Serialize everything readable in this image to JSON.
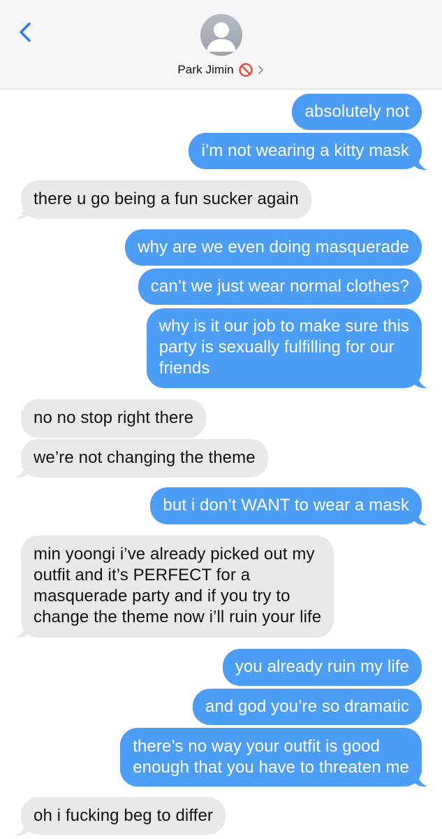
{
  "header": {
    "contact_name": "Park Jimin",
    "back_icon": "chevron-left-icon",
    "mute_icon": "prohibited-icon",
    "disclosure_icon": "chevron-right-icon",
    "colors": {
      "accent": "#3478f6",
      "mute": "#e0543d"
    }
  },
  "colors": {
    "outgoing": "#4b9df6",
    "incoming": "#e9e9eb"
  },
  "messages": [
    {
      "from": "me",
      "text": "absolutely not"
    },
    {
      "from": "me",
      "text": "i’m not wearing a kitty mask"
    },
    {
      "from": "them",
      "text": "there u go being a fun sucker again"
    },
    {
      "from": "me",
      "text": "why are we even doing masquerade"
    },
    {
      "from": "me",
      "text": "can’t we just wear normal clothes?"
    },
    {
      "from": "me",
      "text": "why is it our job to make sure this\nparty is sexually fulfilling for our\nfriends"
    },
    {
      "from": "them",
      "text": "no no stop right there"
    },
    {
      "from": "them",
      "text": "we’re not changing the theme"
    },
    {
      "from": "me",
      "text": "but i don’t WANT to wear a mask"
    },
    {
      "from": "them",
      "text": "min yoongi i’ve already picked out my\noutfit and it’s PERFECT for a\nmasquerade party and if you try to\nchange the theme now i’ll ruin your life"
    },
    {
      "from": "me",
      "text": "you already ruin my life"
    },
    {
      "from": "me",
      "text": "and god you’re so dramatic"
    },
    {
      "from": "me",
      "text": "there’s no way your outfit is good\nenough that you have to threaten me"
    },
    {
      "from": "them",
      "text": "oh i fucking beg to differ"
    }
  ]
}
